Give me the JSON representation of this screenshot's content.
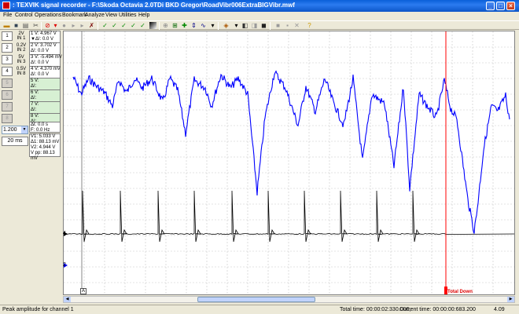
{
  "window": {
    "title": ": TEXVIK  signal recorder - F:\\Skoda Octavia 2.0TDi BKD Gregor\\RoadVibr006ExtraBIGVibr.mwf"
  },
  "menu": [
    "File",
    "Control",
    "Operations",
    "Bookmark",
    "Analyze",
    "View",
    "Utilities",
    "Help"
  ],
  "toolbar_icons": [
    "open-icon",
    "save-icon",
    "print-icon",
    "cut-icon",
    "stop-icon",
    "record-icon",
    "play-icon",
    "fast-forward-icon",
    "tool-icon",
    "check-icon",
    "check-v1-icon",
    "check-v2-icon",
    "check-v3-icon",
    "check-v4-icon",
    "gradient-icon",
    "zoom-icon",
    "zoom-in-icon",
    "move-icon",
    "cursor-icon",
    "wave-icon",
    "cursor-dropdown-icon",
    "palette-icon",
    "mark-icon",
    "mark-off-icon",
    "dark-icon",
    "stop-square-icon",
    "bookmark-icon",
    "close-icon",
    "help-icon"
  ],
  "channels": [
    {
      "id": "1",
      "range": "2V",
      "input": "IN 1",
      "box": [
        "1 V: 4.967 V",
        "▼Δ!: 0.0 V"
      ],
      "enabled": true
    },
    {
      "id": "2",
      "range": "0.2V",
      "input": "IN 2",
      "box": [
        "2 V: 3.702 V",
        "Δ!: 0.0 V"
      ],
      "enabled": true
    },
    {
      "id": "3",
      "range": "5V",
      "input": "IN 3",
      "box": [
        "3 V: -5.494 mV",
        "Δ!: 0.0 V"
      ],
      "enabled": true
    },
    {
      "id": "4",
      "range": "0.5V",
      "input": "IN 8",
      "box": [
        "4 V: 4.370 mV",
        "Δ!: 0.0 V"
      ],
      "enabled": true
    },
    {
      "id": "5",
      "range": "",
      "input": "",
      "box": [
        "5 V:",
        "Δ!:"
      ],
      "enabled": false
    },
    {
      "id": "6",
      "range": "",
      "input": "",
      "box": [
        "6 V:",
        "Δ!:"
      ],
      "enabled": false
    },
    {
      "id": "7",
      "range": "",
      "input": "",
      "box": [
        "7 V:",
        "Δ!:"
      ],
      "enabled": false
    },
    {
      "id": "8",
      "range": "",
      "input": "",
      "box": [
        "8 V:",
        "Δ!:"
      ],
      "enabled": false
    }
  ],
  "measure": {
    "dt": "Δt:       0.0 s",
    "freq": "F:       0.0 Hz"
  },
  "voltages": {
    "v1": "V1: 5.033 V",
    "dv1": "Δ1: 88.13 mV",
    "v2": "V2: 4.944 V",
    "vpp": "V pp: 88.13 mV"
  },
  "scale": "1.200",
  "timebase": "20 ms",
  "plot": {
    "level_4": "4",
    "level_2": "2",
    "cursor_a_label": "A",
    "marker": "Total Down",
    "trace_color": "#0000ff",
    "ref_color": "#000000",
    "marker_color": "#ff0000"
  },
  "status": {
    "hint": "Peak amplitude for channel 1",
    "total_time": "Total time: 00:00:02:330.000,",
    "current_time": "Current time: 00:00:00:683.200",
    "version": "4.09"
  }
}
